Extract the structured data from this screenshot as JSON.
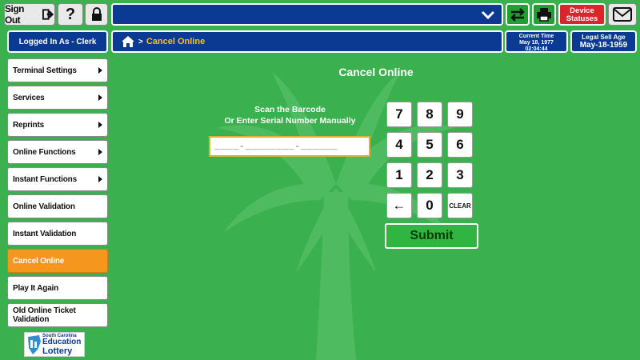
{
  "toolbar": {
    "sign_out_label": "Sign Out",
    "help_label": "?",
    "device_statuses_label": "Device Statuses"
  },
  "header": {
    "logged_in": "Logged In As - Clerk",
    "breadcrumb_current": "Cancel Online",
    "current_time_label": "Current Time",
    "current_date": "May 18, 1977",
    "current_time": "02:04:44",
    "legal_sell_age_label": "Legal Sell Age",
    "legal_sell_age_date": "May-18-1959"
  },
  "sidebar": {
    "items": [
      {
        "label": "Terminal Settings",
        "has_submenu": true
      },
      {
        "label": "Services",
        "has_submenu": true
      },
      {
        "label": "Reprints",
        "has_submenu": true
      },
      {
        "label": "Online Functions",
        "has_submenu": true
      },
      {
        "label": "Instant Functions",
        "has_submenu": true
      },
      {
        "label": "Online Validation",
        "has_submenu": false
      },
      {
        "label": "Instant Validation",
        "has_submenu": false
      },
      {
        "label": "Cancel Online",
        "has_submenu": false,
        "active": true
      },
      {
        "label": "Play It Again",
        "has_submenu": false
      },
      {
        "label": "Old Online Ticket Validation",
        "has_submenu": false
      }
    ]
  },
  "logo": {
    "line1": "South Carolina",
    "line2": "Education",
    "line3": "Lottery"
  },
  "main": {
    "title": "Cancel Online",
    "scan_line1": "Scan the Barcode",
    "scan_line2": "Or Enter Serial Number Manually",
    "serial_placeholder": "____-________-______",
    "keypad": [
      "7",
      "8",
      "9",
      "4",
      "5",
      "6",
      "1",
      "2",
      "3",
      "←",
      "0",
      "CLEAR"
    ],
    "submit_label": "Submit"
  },
  "colors": {
    "background": "#3ab14e",
    "navy": "#0b3a93",
    "active_menu": "#f5961f",
    "device_status": "#d9262b",
    "breadcrumb_text": "#f4c21b"
  }
}
